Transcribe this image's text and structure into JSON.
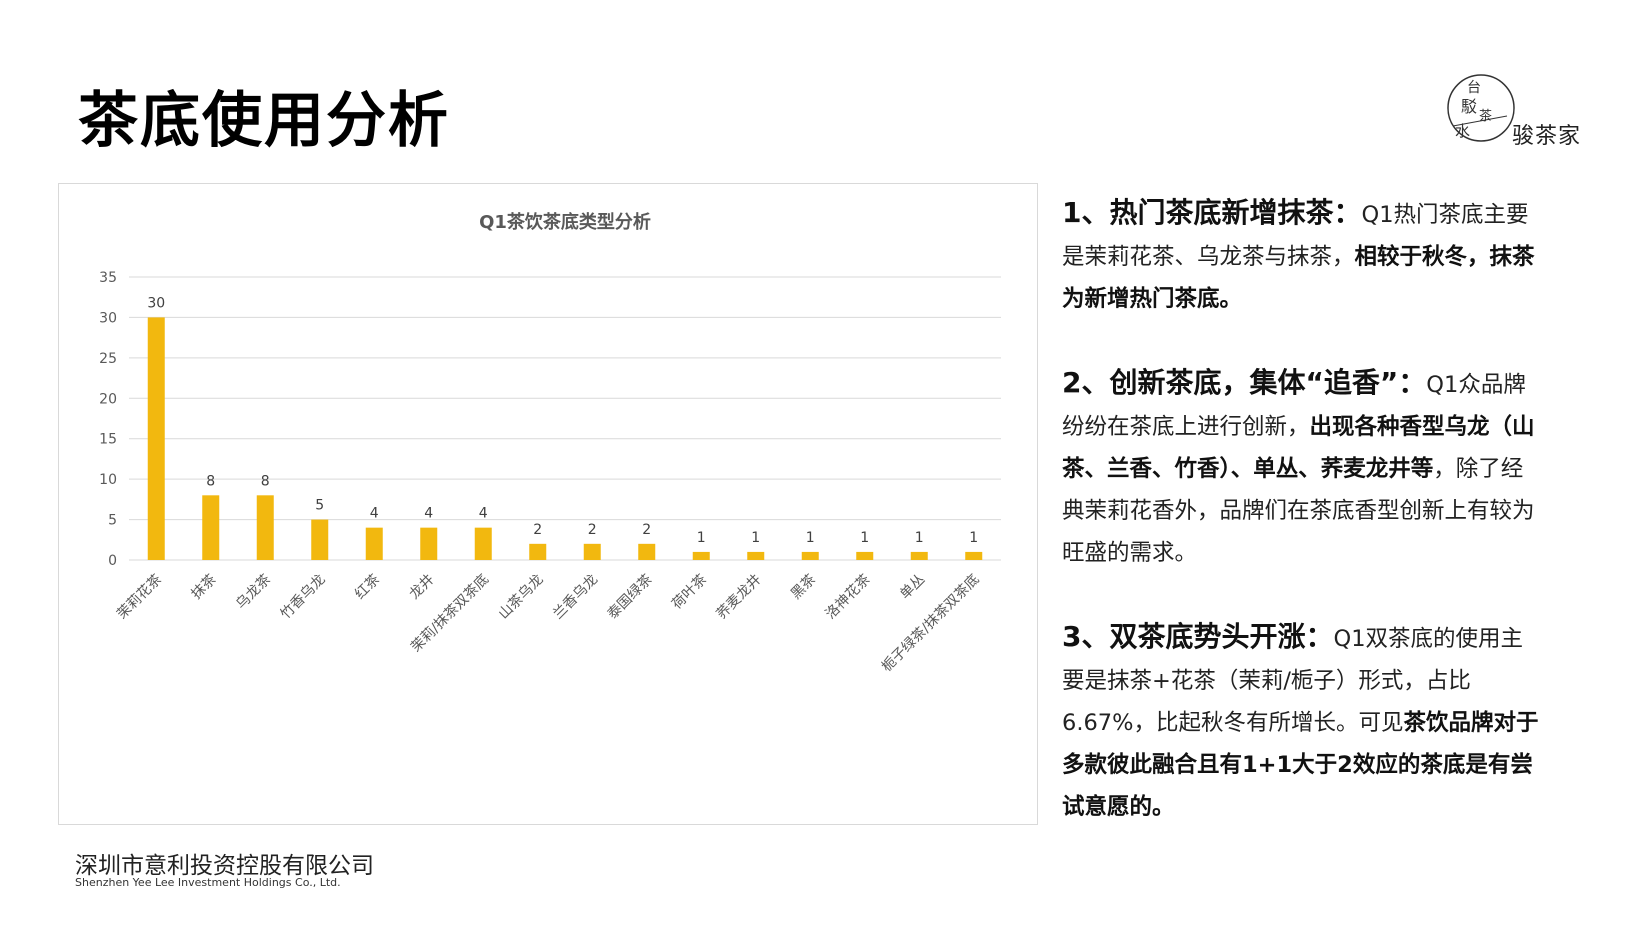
{
  "page": {
    "title": "茶底使用分析",
    "brand_text": "骏茶家",
    "company_cn": "深圳市意利投资控股有限公司",
    "company_en": "Shenzhen Yee Lee Investment Holdings Co., Ltd."
  },
  "chart_data": {
    "type": "bar",
    "title": "Q1茶饮茶底类型分析",
    "xlabel": "",
    "ylabel": "",
    "ylim": [
      0,
      35
    ],
    "yticks": [
      0,
      5,
      10,
      15,
      20,
      25,
      30,
      35
    ],
    "grid": true,
    "bar_color": "#F2B80F",
    "categories": [
      "茉莉花茶",
      "抹茶",
      "乌龙茶",
      "竹香乌龙",
      "红茶",
      "龙井",
      "茉莉/抹茶双茶底",
      "山茶乌龙",
      "兰香乌龙",
      "泰国绿茶",
      "荷叶茶",
      "荞麦龙井",
      "黑茶",
      "洛神花茶",
      "单丛",
      "栀子绿茶/抹茶双茶底"
    ],
    "values": [
      30,
      8,
      8,
      5,
      4,
      4,
      4,
      2,
      2,
      2,
      1,
      1,
      1,
      1,
      1,
      1
    ]
  },
  "points": [
    {
      "heading": "1、热门茶底新增抹茶：",
      "segments": [
        {
          "text": "Q1热门茶底主要是茉莉花茶、乌龙茶与抹茶，",
          "bold": false
        },
        {
          "text": "相较于秋冬，抹茶为新增热门茶底。",
          "bold": true
        }
      ]
    },
    {
      "heading": "2、创新茶底，集体“追香”：",
      "segments": [
        {
          "text": "Q1众品牌纷纷在茶底上进行创新，",
          "bold": false
        },
        {
          "text": "出现各种香型乌龙（山茶、兰香、竹香）、单丛、荞麦龙井等",
          "bold": true
        },
        {
          "text": "，除了经典茉莉花香外，品牌们在茶底香型创新上有较为旺盛的需求。",
          "bold": false
        }
      ]
    },
    {
      "heading": "3、双茶底势头开涨：",
      "segments": [
        {
          "text": "Q1双茶底的使用主要是抹茶+花茶（茉莉/栀子）形式，占比6.67%，比起秋冬有所增长。可见",
          "bold": false
        },
        {
          "text": "茶饮品牌对于多款彼此融合且有1+1大于2效应的茶底是有尝试意愿的。",
          "bold": true
        }
      ]
    }
  ]
}
